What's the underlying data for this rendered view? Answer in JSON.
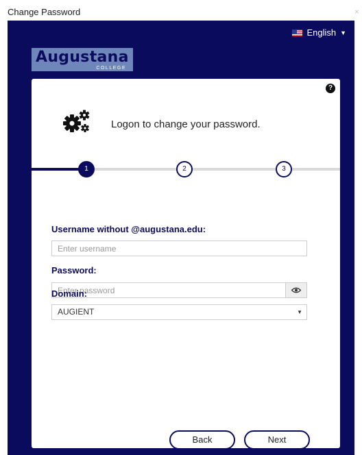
{
  "window": {
    "title": "Change Password",
    "close_glyph": "×"
  },
  "language": {
    "label": "English",
    "flag_icon": "us-flag-icon"
  },
  "logo": {
    "name": "Augustana",
    "subtitle": "COLLEGE"
  },
  "form": {
    "headline": "Logon to change your password.",
    "steps": [
      "1",
      "2",
      "3"
    ],
    "current_step": 1,
    "username": {
      "label": "Username without @augustana.edu:",
      "value": "",
      "placeholder": "Enter username"
    },
    "password": {
      "label": "Password:",
      "value": "",
      "placeholder": "Enter password"
    },
    "domain": {
      "label": "Domain:",
      "selected": "AUGIENT"
    },
    "buttons": {
      "back": "Back",
      "next": "Next"
    }
  },
  "colors": {
    "brand": "#0b0b5e",
    "logo_bg": "#6f86ba",
    "card": "#ffffff"
  }
}
